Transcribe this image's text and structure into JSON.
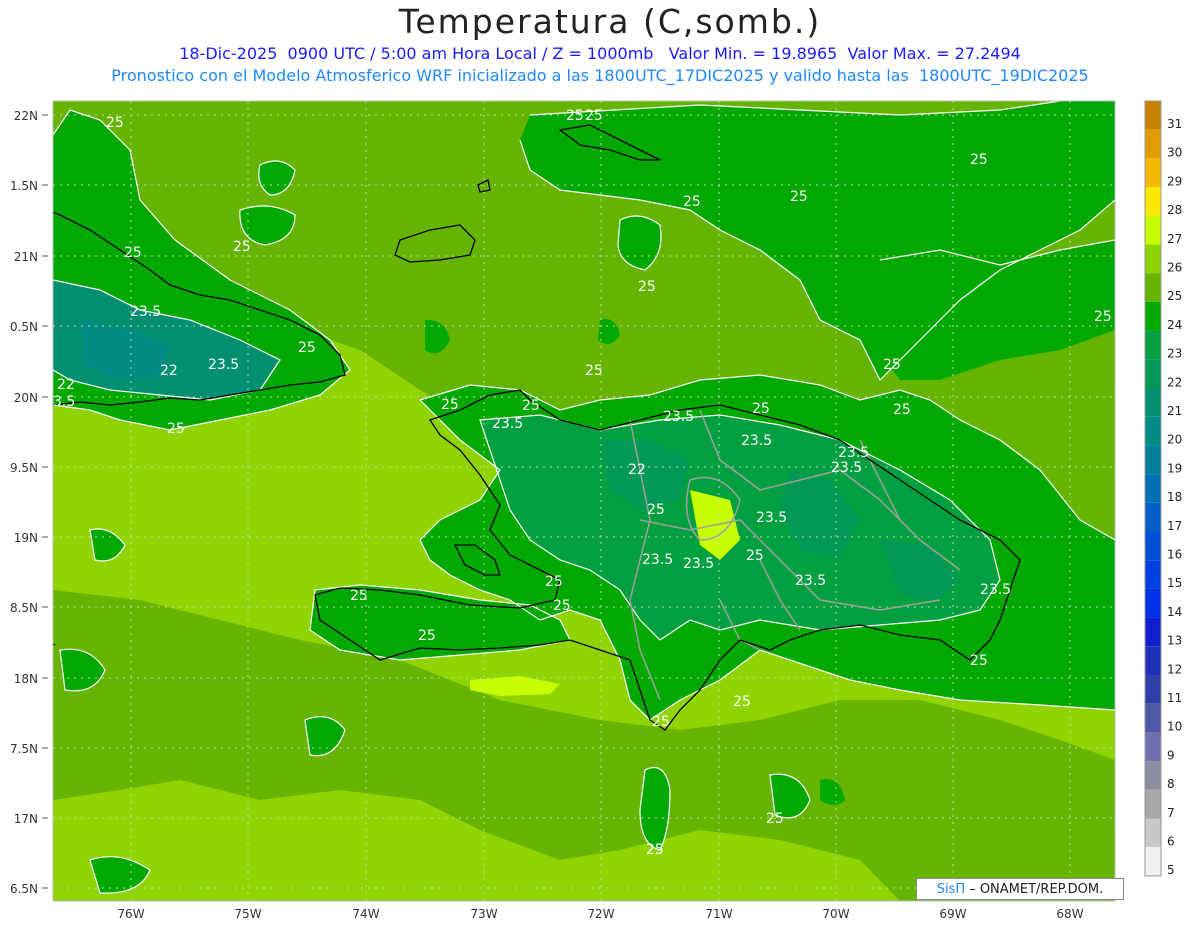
{
  "title": "Temperatura (C,somb.)",
  "subtitle_line1": "18-Dic-2025  0900 UTC / 5:00 am Hora Local / Z = 1000mb   Valor Min. = 19.8965  Valor Max. = 27.2494",
  "subtitle_line2": "Pronostico con el Modelo Atmosferico WRF inicializado a las 1800UTC_17DIC2025 y valido hasta las  1800UTC_19DIC2025",
  "credit": {
    "logo": "SisΠ",
    "text": "– ONAMET/REP.DOM."
  },
  "lat_labels": [
    "22N",
    "1.5N",
    "21N",
    "0.5N",
    "20N",
    "9.5N",
    "19N",
    "8.5N",
    "18N",
    "7.5N",
    "17N",
    "6.5N"
  ],
  "lon_labels": [
    "76W",
    "75W",
    "74W",
    "73W",
    "72W",
    "71W",
    "70W",
    "69W",
    "68W"
  ],
  "colorbar": {
    "levels": [
      "31",
      "30",
      "29",
      "28",
      "27",
      "26",
      "25",
      "24",
      "23",
      "22",
      "21",
      "20",
      "19",
      "18",
      "17",
      "16",
      "15",
      "14",
      "13",
      "12",
      "11",
      "10",
      "9",
      "8",
      "7",
      "6",
      "5"
    ],
    "colors": [
      "#c88200",
      "#e09b00",
      "#f5b800",
      "#ffe800",
      "#c8ff00",
      "#8fd400",
      "#64b400",
      "#00a800",
      "#00a040",
      "#009855",
      "#009070",
      "#008a85",
      "#007e9a",
      "#0070b4",
      "#0060c8",
      "#0050d8",
      "#0040e0",
      "#0030e8",
      "#1020d0",
      "#2030b8",
      "#3040a8",
      "#5058a8",
      "#7070b0",
      "#8c8ca0",
      "#a8a8a8",
      "#c8c8c8",
      "#f0f0f0"
    ]
  },
  "contour_labels": [
    {
      "text": "25"
    },
    {
      "text": "25"
    },
    {
      "text": "25"
    },
    {
      "text": "25"
    },
    {
      "text": "25"
    },
    {
      "text": "25"
    },
    {
      "text": "23.5"
    },
    {
      "text": "22"
    },
    {
      "text": "23.5"
    },
    {
      "text": "22"
    },
    {
      "text": "3.5"
    },
    {
      "text": "25"
    },
    {
      "text": "25"
    },
    {
      "text": "25"
    },
    {
      "text": "25"
    },
    {
      "text": "25"
    },
    {
      "text": "23.5"
    },
    {
      "text": "25"
    },
    {
      "text": "23.5"
    },
    {
      "text": "22"
    },
    {
      "text": "23.5"
    },
    {
      "text": "23.5"
    },
    {
      "text": "23.5"
    },
    {
      "text": "25"
    },
    {
      "text": "23.5"
    },
    {
      "text": "23.5"
    },
    {
      "text": "25"
    },
    {
      "text": "25"
    },
    {
      "text": "25"
    },
    {
      "text": "23.5"
    },
    {
      "text": "25"
    },
    {
      "text": "25"
    },
    {
      "text": "25"
    },
    {
      "text": "25"
    },
    {
      "text": "25"
    },
    {
      "text": "25"
    },
    {
      "text": "25"
    },
    {
      "text": "25"
    },
    {
      "text": "25"
    },
    {
      "text": "25"
    }
  ]
}
